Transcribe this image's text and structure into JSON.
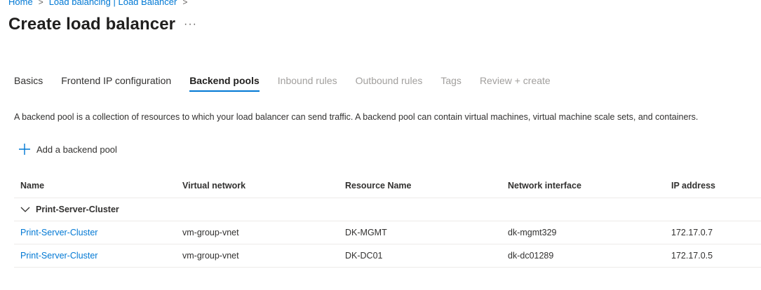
{
  "breadcrumb": {
    "home": "Home",
    "parent": "Load balancing | Load Balancer"
  },
  "page": {
    "title": "Create load balancer",
    "more": "···"
  },
  "tabs": [
    {
      "label": "Basics",
      "state": "enabled"
    },
    {
      "label": "Frontend IP configuration",
      "state": "enabled"
    },
    {
      "label": "Backend pools",
      "state": "active"
    },
    {
      "label": "Inbound rules",
      "state": "disabled"
    },
    {
      "label": "Outbound rules",
      "state": "disabled"
    },
    {
      "label": "Tags",
      "state": "disabled"
    },
    {
      "label": "Review + create",
      "state": "disabled"
    }
  ],
  "description": "A backend pool is a collection of resources to which your load balancer can send traffic. A backend pool can contain virtual machines, virtual machine scale sets, and containers.",
  "add_button": {
    "label": "Add a backend pool",
    "icon": "plus-icon"
  },
  "table": {
    "columns": [
      "Name",
      "Virtual network",
      "Resource Name",
      "Network interface",
      "IP address"
    ],
    "group": {
      "name": "Print-Server-Cluster",
      "icon": "chevron-down-icon"
    },
    "rows": [
      [
        "Print-Server-Cluster",
        "vm-group-vnet",
        "DK-MGMT",
        "dk-mgmt329",
        "172.17.0.7"
      ],
      [
        "Print-Server-Cluster",
        "vm-group-vnet",
        "DK-DC01",
        "dk-dc01289",
        "172.17.0.5"
      ]
    ]
  },
  "colors": {
    "accent": "#0078d4",
    "text": "#323130",
    "disabled": "#a19f9d",
    "divider": "#edebe9"
  }
}
